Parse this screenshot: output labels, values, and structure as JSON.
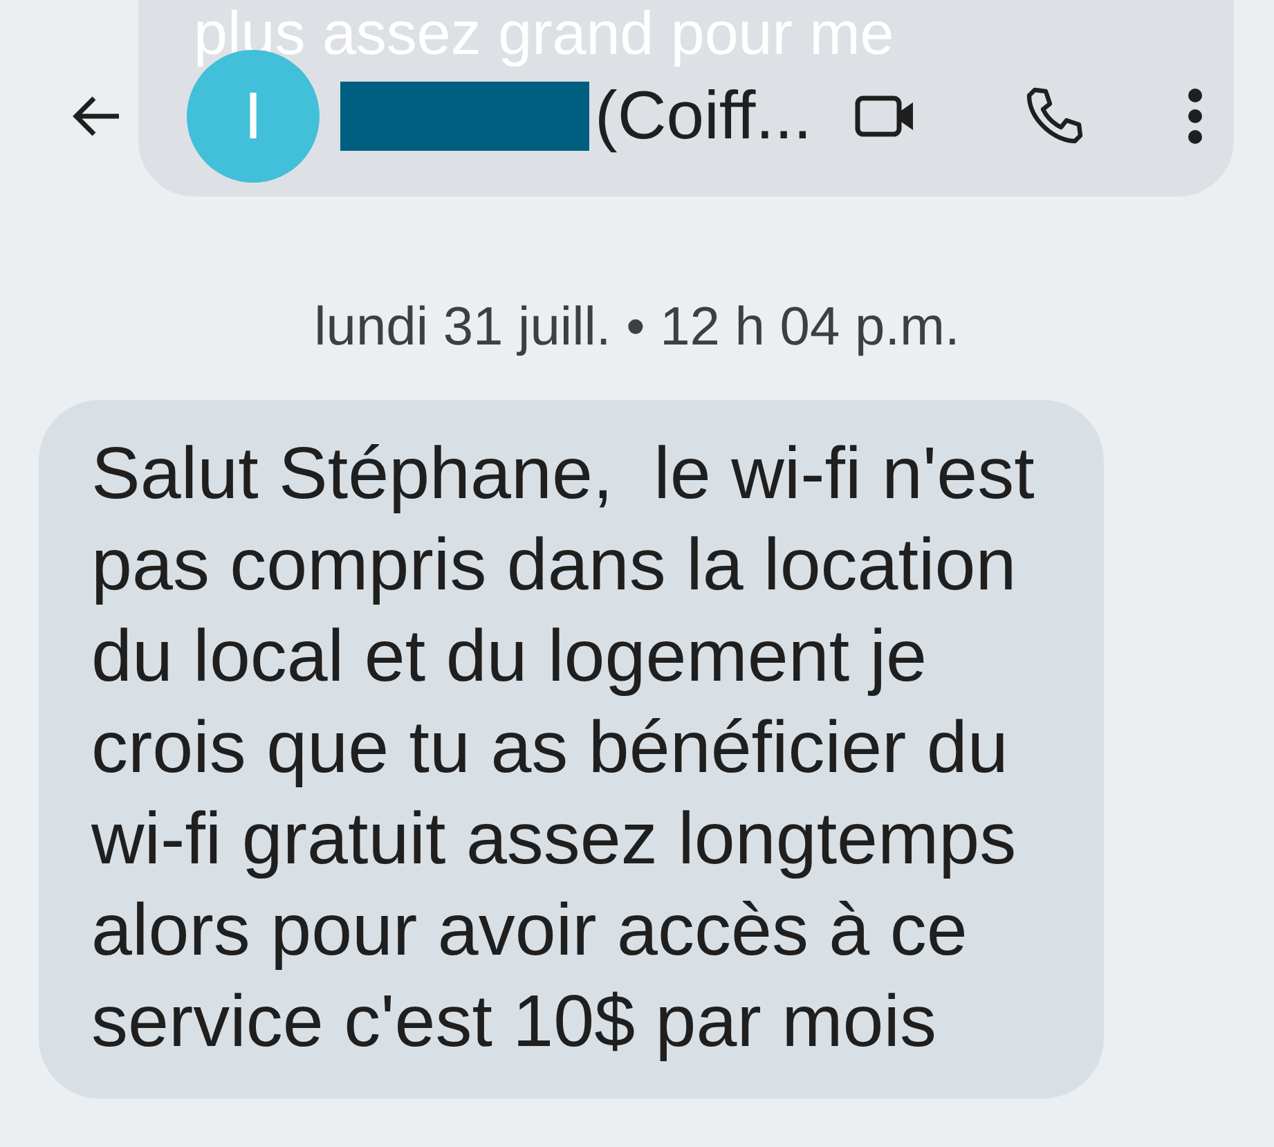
{
  "previous_message": {
    "text": "plus assez grand pour me"
  },
  "header": {
    "avatar_letter": "I",
    "name_redacted": true,
    "contact_name": "(Coiff..."
  },
  "date": "lundi 31 juill. • 12 h 04 p.m.",
  "messages": [
    {
      "kind": "incoming",
      "text": "Salut Stéphane,  le wi-fi n'est\npas compris dans la location\ndu local et du logement je\ncrois que tu as bénéficier du\nwi-fi gratuit assez longtemps\nalors pour avoir accès à ce\nservice c'est 10$ par mois"
    }
  ]
}
